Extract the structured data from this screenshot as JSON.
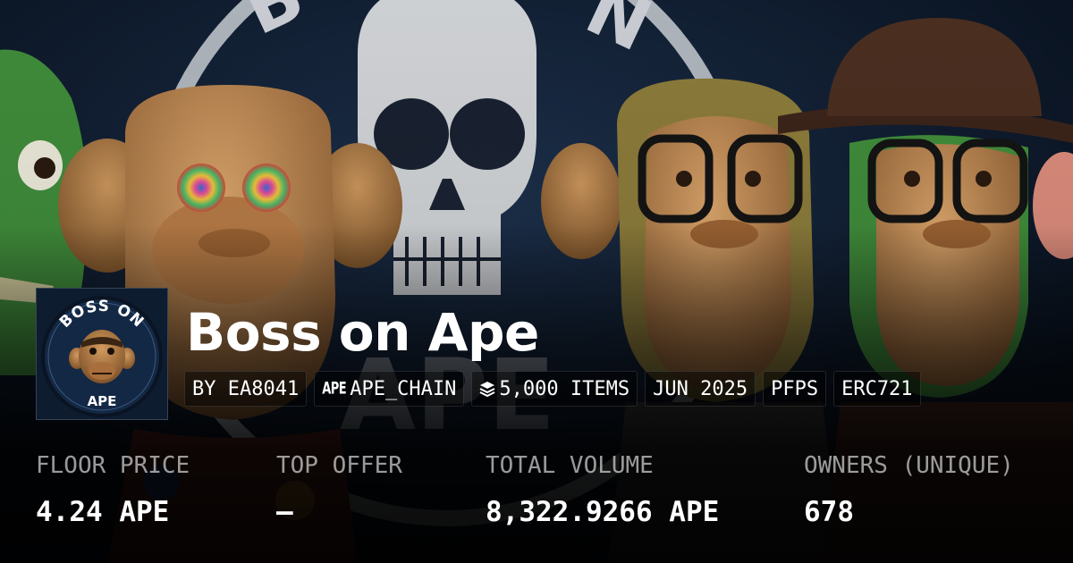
{
  "collection": {
    "name": "Boss on Ape",
    "logo_text_top": "BOSS ON",
    "logo_text_bottom": "APE",
    "background_text": "BOSS ON APE"
  },
  "tags": [
    {
      "text": "BY EA8041",
      "icon": null
    },
    {
      "text": "APE_CHAIN",
      "icon": "apechain-icon",
      "icon_text": "APE"
    },
    {
      "text": "5,000 ITEMS",
      "icon": "layers-icon"
    },
    {
      "text": "JUN 2025",
      "icon": null
    },
    {
      "text": "PFPS",
      "icon": null
    },
    {
      "text": "ERC721",
      "icon": null
    }
  ],
  "stats": [
    {
      "label": "FLOOR PRICE",
      "value": "4.24 APE"
    },
    {
      "label": "TOP OFFER",
      "value": "—"
    },
    {
      "label": "TOTAL VOLUME",
      "value": "8,322.9266 APE"
    },
    {
      "label": "OWNERS (UNIQUE)",
      "value": "678"
    }
  ],
  "colors": {
    "background": "#0b1626",
    "text": "#ffffff",
    "label": "#9a9a9a",
    "ape_skin": "#c8915a",
    "ape_green": "#3f8a3a"
  }
}
